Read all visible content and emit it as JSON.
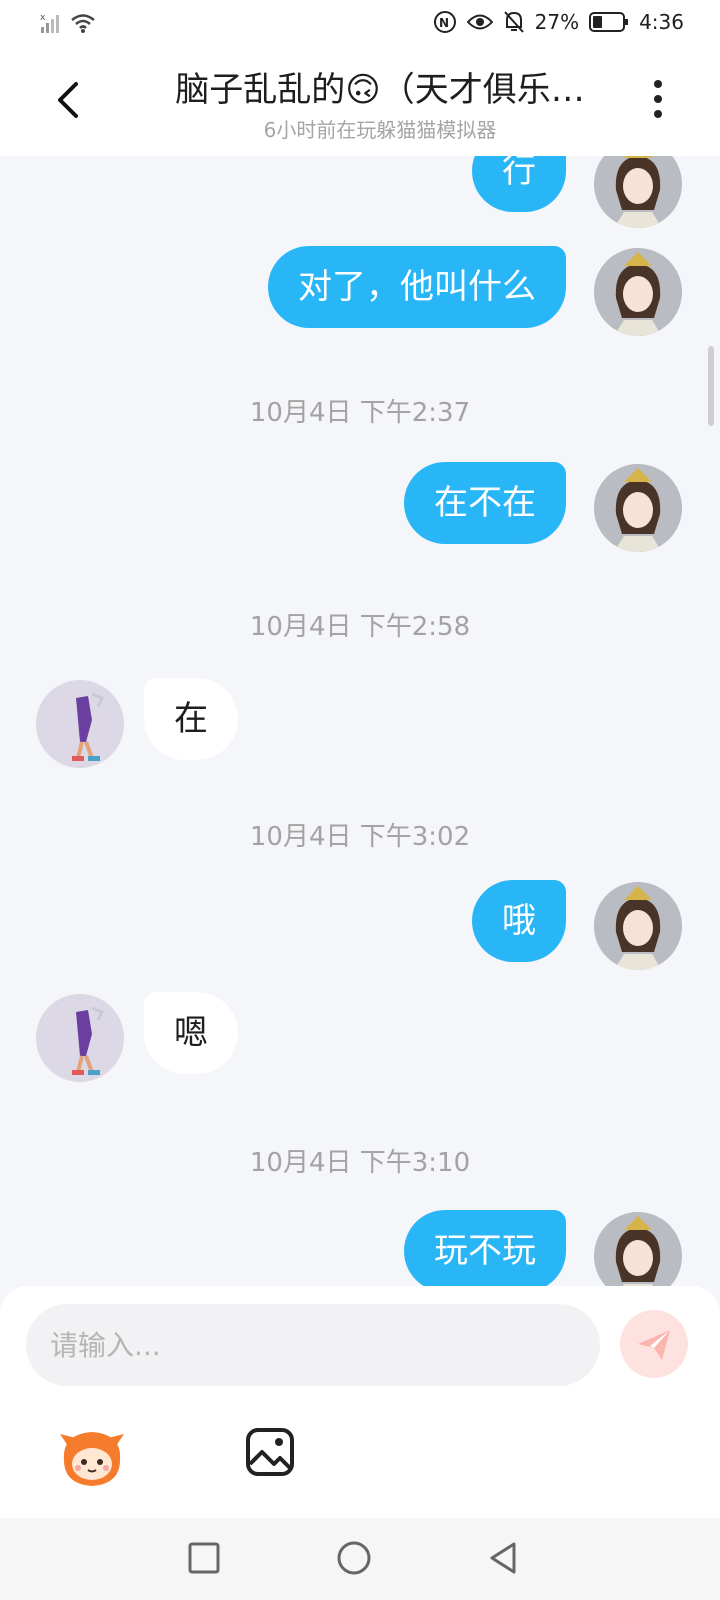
{
  "status_bar": {
    "battery_percent": "27%",
    "time": "4:36",
    "nfc_badge": "N"
  },
  "header": {
    "title": "脑子乱乱的🙃（天才俱乐…",
    "subtitle": "6小时前在玩躲猫猫模拟器"
  },
  "messages": [
    {
      "type": "message",
      "sender": "self",
      "text": "行"
    },
    {
      "type": "message",
      "sender": "self",
      "text": "对了，他叫什么"
    },
    {
      "type": "timestamp",
      "text": "10月4日 下午2:37"
    },
    {
      "type": "message",
      "sender": "self",
      "text": "在不在"
    },
    {
      "type": "timestamp",
      "text": "10月4日 下午2:58"
    },
    {
      "type": "message",
      "sender": "other",
      "text": "在"
    },
    {
      "type": "timestamp",
      "text": "10月4日 下午3:02"
    },
    {
      "type": "message",
      "sender": "self",
      "text": "哦"
    },
    {
      "type": "message",
      "sender": "other",
      "text": "嗯"
    },
    {
      "type": "timestamp",
      "text": "10月4日 下午3:10"
    },
    {
      "type": "message",
      "sender": "self",
      "text": "玩不玩"
    }
  ],
  "input": {
    "placeholder": "请输入..."
  },
  "colors": {
    "self_bubble": "#29b6f6",
    "other_bubble": "#ffffff",
    "send_button_bg": "#fde2e0",
    "send_icon": "#f58e86",
    "chat_background": "#f4f6f9"
  },
  "icons": {
    "back": "chevron-left-icon",
    "more": "more-vertical-icon",
    "send": "paper-plane-icon",
    "emoji": "mascot-emoji-icon",
    "image": "image-icon"
  }
}
